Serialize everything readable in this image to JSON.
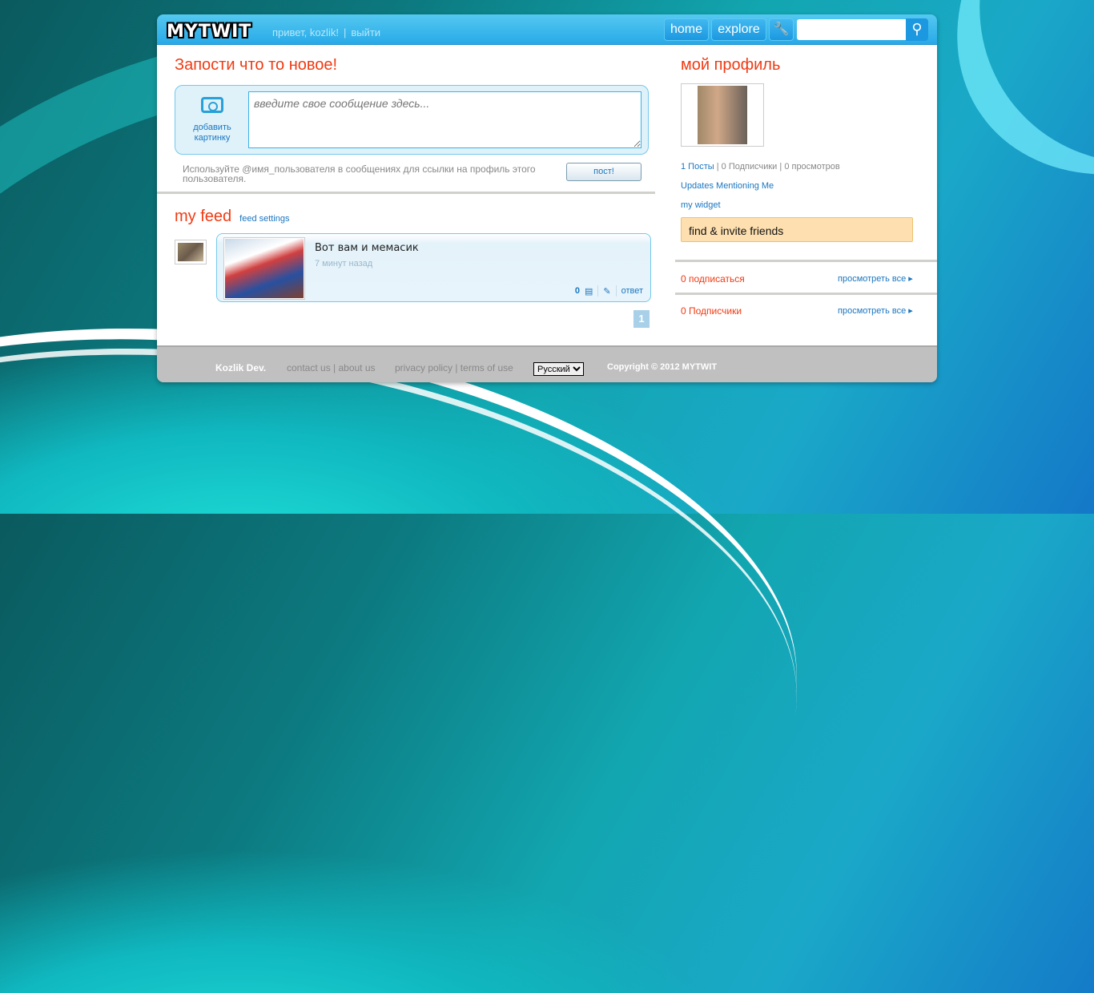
{
  "header": {
    "logo": "MYTWIT",
    "greeting": "привет, kozlik!",
    "separator": "|",
    "logout": "выйти",
    "nav": {
      "home": "home",
      "explore": "explore"
    },
    "search_placeholder": ""
  },
  "compose": {
    "title": "Запости что то новое!",
    "add_picture": "добавить картинку",
    "placeholder": "введите свое сообщение здесь...",
    "hint": "Используйте @имя_пользователя в сообщениях для ссылки на профиль этого пользователя.",
    "post_button": "пост!"
  },
  "feed": {
    "title": "my feed",
    "settings": "feed settings",
    "items": [
      {
        "text": "Вот вам и мемасик",
        "time": "7 минут назад",
        "comments": "0",
        "reply": "ответ"
      }
    ],
    "page": "1"
  },
  "profile": {
    "title": "мой профиль",
    "posts": "1 Посты",
    "followers_stat": "0 Подписчики",
    "views": "0 просмотров",
    "mentions": "Updates Mentioning Me",
    "widget": "my widget",
    "invite": "find & invite friends",
    "following": "0 подписаться",
    "followers": "0 Подписчики",
    "view_all": "просмотреть все"
  },
  "footer": {
    "brand": "Kozlik Dev.",
    "links1": "contact us | about us",
    "links2": "privacy policy | terms of use",
    "language": "Русский",
    "copyright": "Copyright © 2012 MYTWIT"
  }
}
